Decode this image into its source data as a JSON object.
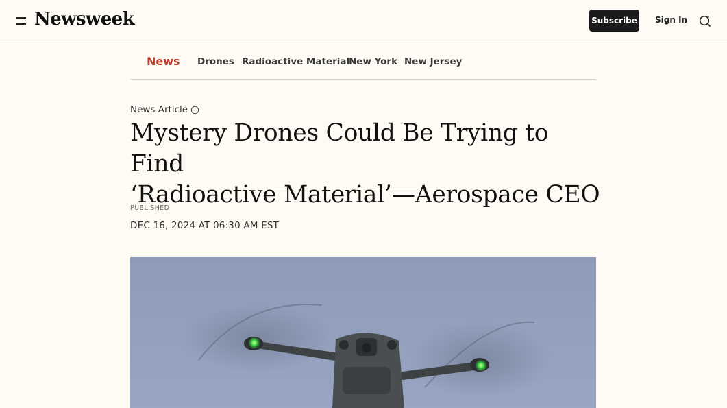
{
  "header": {
    "logo": "Newsweek",
    "subscribe_label": "Subscribe",
    "signin_label": "Sign In"
  },
  "topics": {
    "main": "News",
    "items": [
      "Drones",
      "Radioactive Material",
      "New York",
      "New Jersey"
    ]
  },
  "article": {
    "type": "News Article",
    "headline_line1": "Mystery Drones Could Be Trying to Find",
    "headline_line2": "‘Radioactive Material’—Aerospace CEO",
    "published_label": "PUBLISHED",
    "published_date": "DEC 16, 2024 AT 06:30 AM EST"
  },
  "colors": {
    "background": "#fdfbf3",
    "accent": "#c0392b",
    "button_dark": "#1b1b1b"
  },
  "icons": [
    "hamburger-menu-icon",
    "search-icon",
    "info-icon"
  ]
}
